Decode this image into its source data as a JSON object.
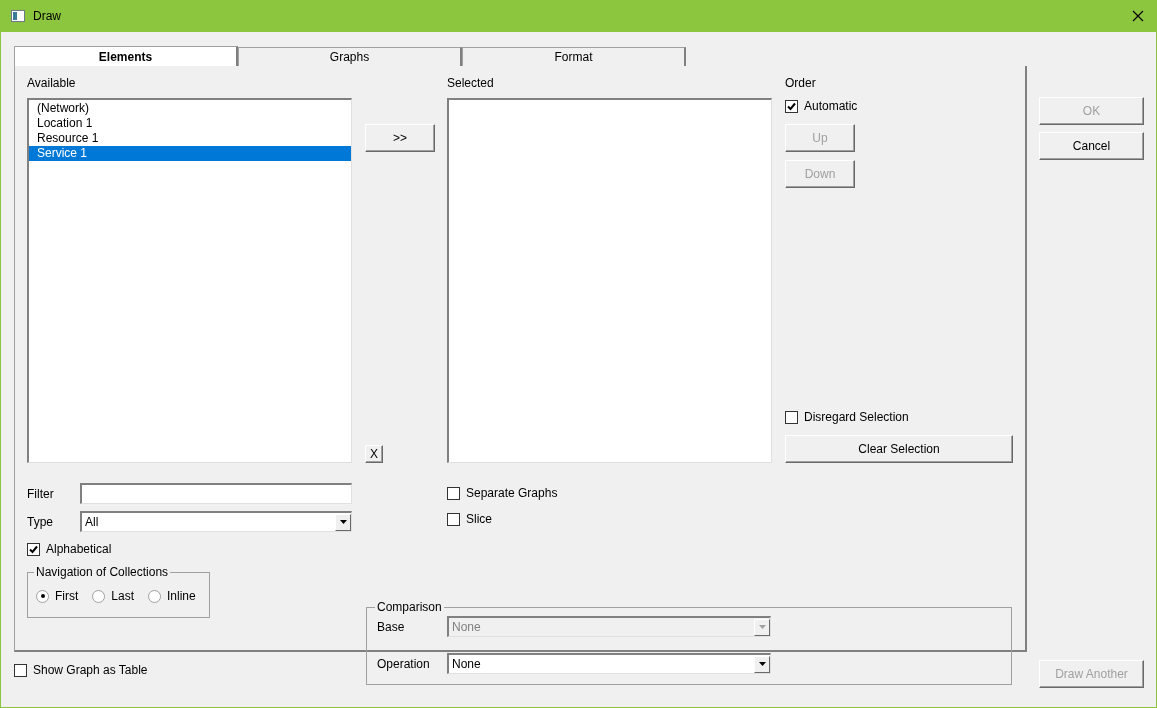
{
  "window": {
    "title": "Draw"
  },
  "tabs": [
    {
      "label": "Elements",
      "selected": true
    },
    {
      "label": "Graphs",
      "selected": false
    },
    {
      "label": "Format",
      "selected": false
    }
  ],
  "available": {
    "label": "Available",
    "items": [
      {
        "label": "(Network)",
        "selected": false
      },
      {
        "label": "Location 1",
        "selected": false
      },
      {
        "label": "Resource 1",
        "selected": false
      },
      {
        "label": "Service 1",
        "selected": true
      }
    ]
  },
  "add_button": ">>",
  "remove_button": "X",
  "selected_list": {
    "label": "Selected"
  },
  "order": {
    "label": "Order",
    "automatic": {
      "label": "Automatic",
      "checked": true
    },
    "buttons": [
      {
        "label": "Up",
        "disabled": true
      },
      {
        "label": "Down",
        "disabled": true
      }
    ]
  },
  "disregard_selection": {
    "label": "Disregard Selection",
    "checked": false
  },
  "clear_selection_button": "Clear Selection",
  "filter": {
    "label": "Filter"
  },
  "type": {
    "label": "Type",
    "value": "All",
    "disabled": false
  },
  "alphabetical": {
    "label": "Alphabetical",
    "checked": true
  },
  "navigation": {
    "title": "Navigation of Collections",
    "options": [
      {
        "label": "First",
        "selected": true
      },
      {
        "label": "Last",
        "selected": false
      },
      {
        "label": "Inline",
        "selected": false
      }
    ]
  },
  "separate_graphs": {
    "label": "Separate Graphs",
    "checked": false
  },
  "slice": {
    "label": "Slice",
    "checked": false
  },
  "comparison": {
    "title": "Comparison",
    "base": {
      "label": "Base",
      "value": "None",
      "disabled": true
    },
    "operation": {
      "label": "Operation",
      "value": "None",
      "disabled": false
    }
  },
  "dialog_buttons": [
    {
      "label": "OK",
      "disabled": true
    },
    {
      "label": "Cancel",
      "disabled": false
    }
  ],
  "show_graph_as_table": {
    "label": "Show Graph as Table",
    "checked": false
  },
  "draw_another": {
    "label": "Draw Another",
    "disabled": true
  }
}
